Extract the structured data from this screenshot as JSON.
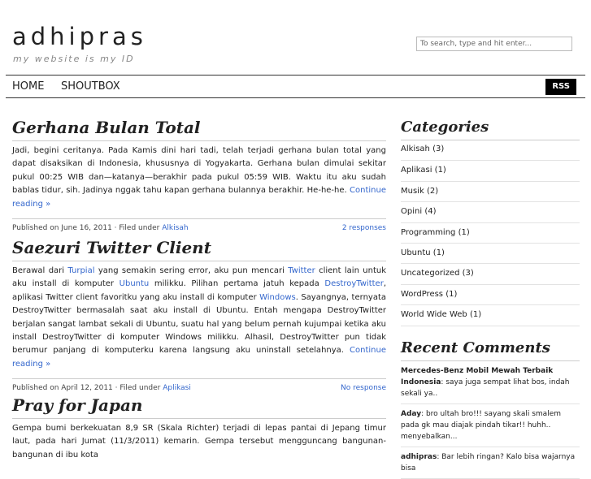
{
  "header": {
    "site_title": "adhipras",
    "tagline": "my website is my ID",
    "search_placeholder": "To search, type and hit enter..."
  },
  "nav": {
    "items": [
      "HOME",
      "SHOUTBOX"
    ],
    "rss_label": "RSS"
  },
  "posts": [
    {
      "title": "Gerhana Bulan Total",
      "body": "Jadi, begini ceritanya. Pada Kamis dini hari tadi, telah terjadi gerhana bulan total yang dapat disaksikan di Indonesia, khususnya di Yogyakarta. Gerhana bulan dimulai sekitar pukul 00:25 WIB dan—katanya—berakhir pada pukul 05:59 WIB. Waktu itu aku sudah bablas tidur, sih. Jadinya nggak tahu kapan gerhana bulannya berakhir. He-he-he.",
      "continue": "Continue reading »",
      "published": "Published on June 16, 2011 · Filed under",
      "category": "Alkisah",
      "comments": "2 responses"
    },
    {
      "title": "Saezuri Twitter Client",
      "body_parts": [
        "Berawal dari ",
        "Turpial",
        " yang semakin sering error, aku pun mencari ",
        "Twitter",
        " client lain untuk aku install di komputer ",
        "Ubuntu",
        " milikku. Pilihan pertama jatuh kepada ",
        "DestroyTwitter",
        ", aplikasi Twitter client favoritku yang aku install di komputer ",
        "Windows",
        ". Sayangnya, ternyata DestroyTwitter bermasalah saat aku install di Ubuntu. Entah mengapa DestroyTwitter berjalan sangat lambat sekali di Ubuntu, suatu hal yang belum pernah kujumpai ketika aku install DestroyTwitter di komputer Windows milikku. Alhasil, DestroyTwitter pun tidak berumur panjang di komputerku karena langsung aku uninstall setelahnya. "
      ],
      "continue": "Continue reading »",
      "published": "Published on April 12, 2011 · Filed under",
      "category": "Aplikasi",
      "comments": "No response"
    },
    {
      "title": "Pray for Japan",
      "body": "Gempa bumi berkekuatan 8,9 SR (Skala Richter) terjadi di lepas pantai di Jepang timur laut, pada hari Jumat (11/3/2011) kemarin. Gempa tersebut mengguncang bangunan-bangunan di ibu kota"
    }
  ],
  "sidebar": {
    "categories_title": "Categories",
    "categories": [
      {
        "name": "Alkisah",
        "count": "(3)"
      },
      {
        "name": "Aplikasi",
        "count": "(1)"
      },
      {
        "name": "Musik",
        "count": "(2)"
      },
      {
        "name": "Opini",
        "count": "(4)"
      },
      {
        "name": "Programming",
        "count": "(1)"
      },
      {
        "name": "Ubuntu",
        "count": "(1)"
      },
      {
        "name": "Uncategorized",
        "count": "(3)"
      },
      {
        "name": "WordPress",
        "count": "(1)"
      },
      {
        "name": "World Wide Web",
        "count": "(1)"
      }
    ],
    "comments_title": "Recent Comments",
    "comments": [
      {
        "author": "Mercedes-Benz Mobil Mewah Terbaik Indonesia",
        "text": ": saya juga sempat lihat bos, indah sekali ya.."
      },
      {
        "author": "Aday",
        "text": ": bro ultah bro!!! sayang skali smalem pada gk mau diajak pindah tikar!! huhh.. menyebalkan..."
      },
      {
        "author": "adhipras",
        "text": ": Bar lebih ringan? Kalo bisa wajarnya bisa"
      }
    ]
  }
}
